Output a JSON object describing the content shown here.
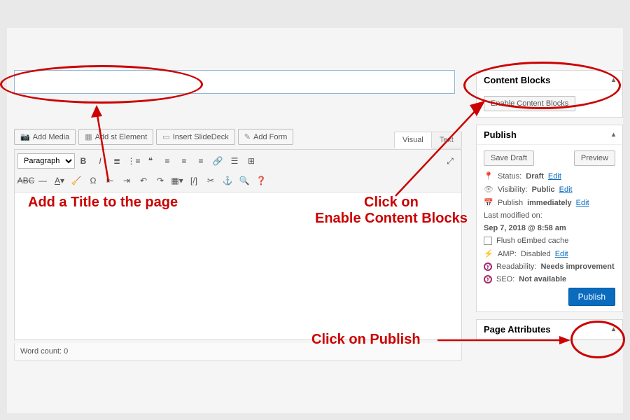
{
  "title_input": {
    "value": "",
    "placeholder": ""
  },
  "media_buttons": {
    "add_media": "Add Media",
    "add_element": "Add      st Element",
    "insert_slidedeck": "Insert SlideDeck",
    "add_form": "Add Form"
  },
  "editor": {
    "tabs": {
      "visual": "Visual",
      "text": "Text"
    },
    "paragraph": "Paragraph",
    "word_count_label": "Word count:",
    "word_count_value": "0"
  },
  "sidebar": {
    "content_blocks": {
      "title": "Content Blocks",
      "button": "Enable Content Blocks"
    },
    "publish": {
      "title": "Publish",
      "save_draft": "Save Draft",
      "preview": "Preview",
      "status_label": "Status:",
      "status_value": "Draft",
      "edit": "Edit",
      "visibility_label": "Visibility:",
      "visibility_value": "Public",
      "schedule_label": "Publish",
      "schedule_value": "immediately",
      "last_modified_label": "Last modified on:",
      "last_modified_value": "Sep 7, 2018 @ 8:58 am",
      "flush_label": "Flush oEmbed cache",
      "amp_label": "AMP:",
      "amp_value": "Disabled",
      "readability_label": "Readability:",
      "readability_value": "Needs improvement",
      "seo_label": "SEO:",
      "seo_value": "Not available",
      "publish_button": "Publish"
    },
    "page_attributes": {
      "title": "Page Attributes"
    }
  },
  "annotations": {
    "title": "Add a Title to the page",
    "enable_blocks_line1": "Click on",
    "enable_blocks_line2": "Enable Content Blocks",
    "publish": "Click on Publish"
  }
}
